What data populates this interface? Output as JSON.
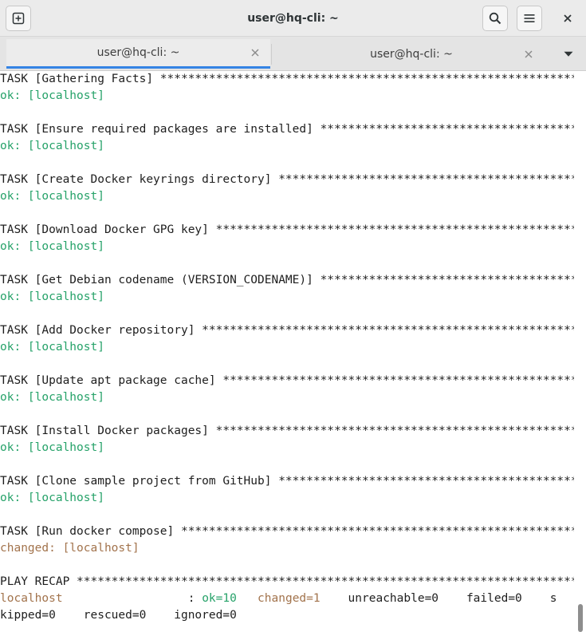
{
  "window": {
    "title": "user@hq-cli: ~"
  },
  "tabs": [
    {
      "label": "user@hq-cli: ~",
      "active": true
    },
    {
      "label": "user@hq-cli: ~",
      "active": false
    }
  ],
  "icons": {
    "new_tab": "new-tab-icon",
    "search": "search-icon",
    "menu": "hamburger-menu-icon",
    "close": "close-icon",
    "dropdown": "chevron-down-icon"
  },
  "colors": {
    "ok": "#26a269",
    "changed": "#a2734c",
    "text": "#1e1e1e",
    "tab_accent": "#3584e4"
  },
  "terminal": {
    "lines": [
      [
        {
          "t": "TASK [Gathering Facts] *********************************************************************",
          "c": "plain"
        }
      ],
      [
        {
          "t": "ok: [localhost]",
          "c": "green"
        }
      ],
      [],
      [
        {
          "t": "TASK [Ensure required packages are installed] **********************************************",
          "c": "plain"
        }
      ],
      [
        {
          "t": "ok: [localhost]",
          "c": "green"
        }
      ],
      [],
      [
        {
          "t": "TASK [Create Docker keyrings directory] ****************************************************",
          "c": "plain"
        }
      ],
      [
        {
          "t": "ok: [localhost]",
          "c": "green"
        }
      ],
      [],
      [
        {
          "t": "TASK [Download Docker GPG key] *************************************************************",
          "c": "plain"
        }
      ],
      [
        {
          "t": "ok: [localhost]",
          "c": "green"
        }
      ],
      [],
      [
        {
          "t": "TASK [Get Debian codename (VERSION_CODENAME)] **********************************************",
          "c": "plain"
        }
      ],
      [
        {
          "t": "ok: [localhost]",
          "c": "green"
        }
      ],
      [],
      [
        {
          "t": "TASK [Add Docker repository] ***************************************************************",
          "c": "plain"
        }
      ],
      [
        {
          "t": "ok: [localhost]",
          "c": "green"
        }
      ],
      [],
      [
        {
          "t": "TASK [Update apt package cache] ************************************************************",
          "c": "plain"
        }
      ],
      [
        {
          "t": "ok: [localhost]",
          "c": "green"
        }
      ],
      [],
      [
        {
          "t": "TASK [Install Docker packages] *************************************************************",
          "c": "plain"
        }
      ],
      [
        {
          "t": "ok: [localhost]",
          "c": "green"
        }
      ],
      [],
      [
        {
          "t": "TASK [Clone sample project from GitHub] ****************************************************",
          "c": "plain"
        }
      ],
      [
        {
          "t": "ok: [localhost]",
          "c": "green"
        }
      ],
      [],
      [
        {
          "t": "TASK [Run docker compose] ******************************************************************",
          "c": "plain"
        }
      ],
      [
        {
          "t": "changed: [localhost]",
          "c": "orange"
        }
      ],
      [],
      [
        {
          "t": "PLAY RECAP *********************************************************************************",
          "c": "plain"
        }
      ],
      [
        {
          "t": "localhost",
          "c": "orange"
        },
        {
          "t": "                  : ",
          "c": "plain"
        },
        {
          "t": "ok=10",
          "c": "green"
        },
        {
          "t": "   ",
          "c": "plain"
        },
        {
          "t": "changed=1",
          "c": "orange"
        },
        {
          "t": "    unreachable=0    failed=0    s",
          "c": "plain"
        }
      ],
      [
        {
          "t": "kipped=0    rescued=0    ignored=0",
          "c": "plain"
        }
      ]
    ]
  }
}
